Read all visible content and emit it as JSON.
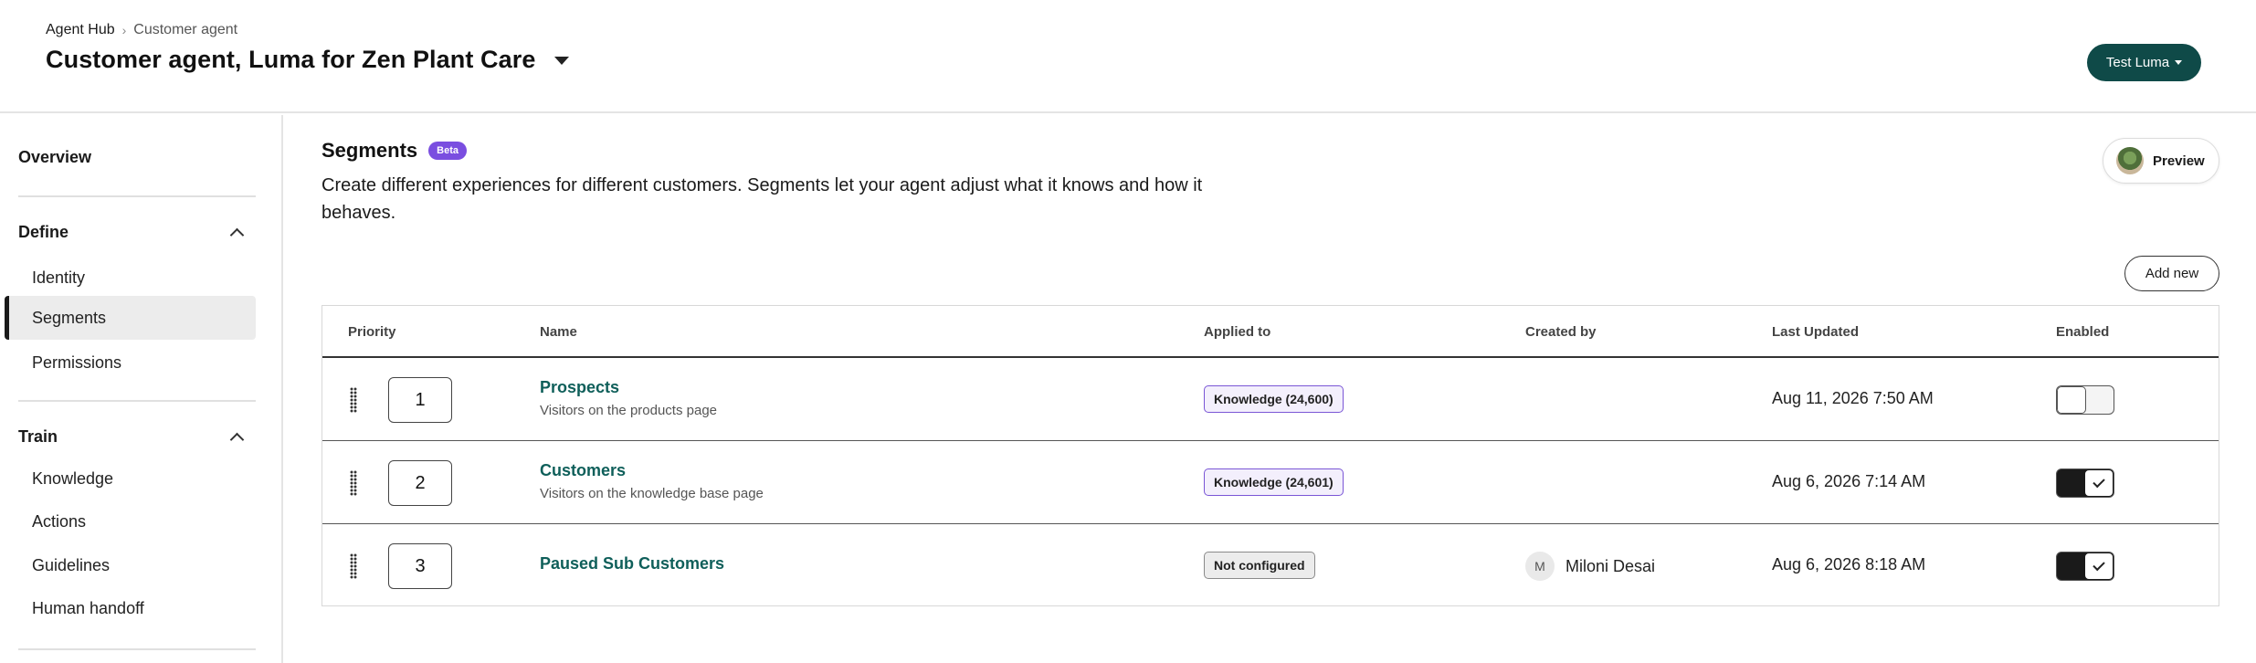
{
  "header": {
    "breadcrumb_root": "Agent Hub",
    "breadcrumb_sep": "›",
    "breadcrumb_current": "Customer agent",
    "title": "Customer agent, Luma for Zen Plant Care",
    "test_button": "Test Luma"
  },
  "sidebar": {
    "overview": "Overview",
    "sections": [
      {
        "label": "Define",
        "items": [
          {
            "label": "Identity"
          },
          {
            "label": "Segments",
            "active": true
          },
          {
            "label": "Permissions"
          }
        ]
      },
      {
        "label": "Train",
        "items": [
          {
            "label": "Knowledge"
          },
          {
            "label": "Actions"
          },
          {
            "label": "Guidelines"
          },
          {
            "label": "Human handoff"
          }
        ]
      }
    ]
  },
  "main": {
    "title": "Segments",
    "badge": "Beta",
    "description": "Create different experiences for different customers. Segments let your agent adjust what it knows and how it behaves.",
    "preview_button": "Preview",
    "add_button": "Add new",
    "columns": [
      "Priority",
      "Name",
      "Applied to",
      "Created by",
      "Last Updated",
      "Enabled"
    ],
    "rows": [
      {
        "priority": "1",
        "name": "Prospects",
        "subtitle": "Visitors on the products page",
        "applied_to": "Knowledge (24,600)",
        "applied_type": "knowledge",
        "created_by": "",
        "creator_initial": "",
        "last_updated": "Aug 11, 2026 7:50 AM",
        "enabled": false
      },
      {
        "priority": "2",
        "name": "Customers",
        "subtitle": "Visitors on the knowledge base page",
        "applied_to": "Knowledge (24,601)",
        "applied_type": "knowledge",
        "created_by": "",
        "creator_initial": "",
        "last_updated": "Aug 6, 2026 7:14 AM",
        "enabled": true
      },
      {
        "priority": "3",
        "name": "Paused Sub Customers",
        "subtitle": "",
        "applied_to": "Not configured",
        "applied_type": "notconf",
        "created_by": "Miloni Desai",
        "creator_initial": "M",
        "last_updated": "Aug 6, 2026 8:18 AM",
        "enabled": true
      }
    ]
  },
  "colors": {
    "accent": "#0f4a48",
    "link": "#0f5f5a",
    "beta": "#7a4ee0"
  },
  "icons": {
    "title_dropdown": "caret-down-icon",
    "section_toggle": "chevron-up-icon",
    "drag": "drag-handle-icon",
    "check": "check-icon"
  }
}
